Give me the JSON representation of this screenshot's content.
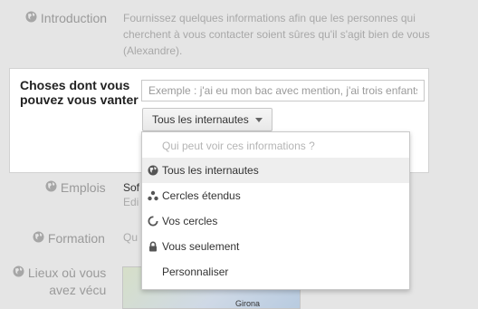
{
  "intro": {
    "label": "Introduction",
    "text": "Fournissez quelques informations afin que les personnes qui cherchent à vous contacter soient sûres qu'il s'agit bien de vous (Alexandre).",
    "icon": "globe-icon"
  },
  "brag": {
    "title": "Choses dont vous pouvez vous vanter",
    "placeholder": "Exemple : j'ai eu mon bac avec mention, j'ai trois enfants",
    "audience_button": "Tous les internautes"
  },
  "menu": {
    "header": "Qui peut voir ces informations ?",
    "items": [
      {
        "label": "Tous les internautes",
        "icon": "globe-icon",
        "selected": true
      },
      {
        "label": "Cercles étendus",
        "icon": "extended-circles-icon",
        "selected": false
      },
      {
        "label": "Vos cercles",
        "icon": "circles-icon",
        "selected": false
      },
      {
        "label": "Vous seulement",
        "icon": "lock-icon",
        "selected": false
      },
      {
        "label": "Personnaliser",
        "icon": "",
        "selected": false
      }
    ]
  },
  "emplois": {
    "label": "Emplois",
    "value": "Sof",
    "sub": "Edi"
  },
  "formation": {
    "label": "Formation",
    "value": "Qu"
  },
  "lieux": {
    "label_line1": "Lieux où vous",
    "label_line2": "avez vécu",
    "map_city": "Girona"
  },
  "colors": {
    "background": "#e5e5e5",
    "card": "#ffffff",
    "selected_row": "#eeeeee",
    "muted_text": "#9a9a9a"
  }
}
